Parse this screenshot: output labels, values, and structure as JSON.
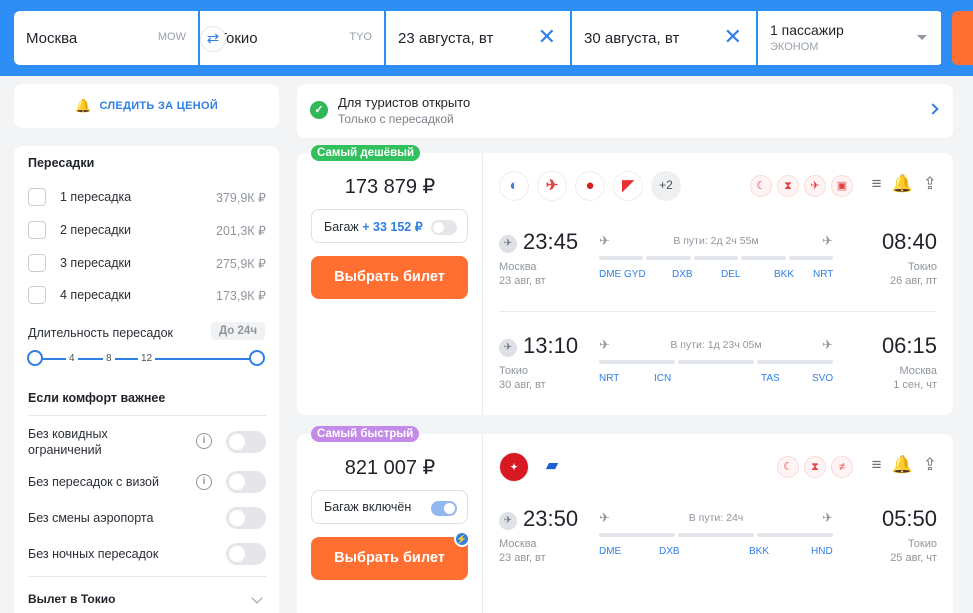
{
  "search": {
    "from": "Москва",
    "from_code": "MOW",
    "to": "Токио",
    "to_code": "TYO",
    "depart_date": "23 августа, вт",
    "return_date": "30 августа, вт",
    "passengers": "1 пассажир",
    "cabin": "ЭКОНОМ"
  },
  "track_price": "СЛЕДИТЬ ЗА ЦЕНОЙ",
  "filters": {
    "stops_title": "Пересадки",
    "stops": [
      {
        "label": "1 пересадка",
        "price": "379,9К ₽"
      },
      {
        "label": "2 пересадки",
        "price": "201,3К ₽"
      },
      {
        "label": "3 пересадки",
        "price": "275,9К ₽"
      },
      {
        "label": "4 пересадки",
        "price": "173,9К ₽"
      }
    ],
    "duration_label": "Длительность пересадок",
    "duration_badge": "До 24ч",
    "duration_ticks": [
      "4",
      "8",
      "12"
    ],
    "comfort_title": "Если комфорт важнее",
    "comfort": [
      {
        "label": "Без ковидных ограничений"
      },
      {
        "label": "Без пересадок с визой"
      },
      {
        "label": "Без смены аэропорта"
      },
      {
        "label": "Без ночных пересадок"
      }
    ],
    "departure_title": "Вылет в Токио"
  },
  "notice": {
    "title": "Для туристов открыто",
    "subtitle": "Только с пересадкой"
  },
  "tickets": [
    {
      "tag": "Самый дешёвый",
      "price": "173 879 ₽",
      "baggage_label": "Багаж",
      "baggage_price": "+ 33 152 ₽",
      "baggage_on": false,
      "buy": "Выбрать билет",
      "extra_airlines": "+2",
      "segments": [
        {
          "dep_time": "23:45",
          "arr_time": "08:40",
          "dep_city": "Москва",
          "dep_date": "23 авг, вт",
          "arr_city": "Токио",
          "arr_date": "26 авг, пт",
          "duration": "В пути: 2д 2ч 55м",
          "stops": [
            "DME",
            "GYD",
            "DXB",
            "DEL",
            "BKK",
            "NRT"
          ]
        },
        {
          "dep_time": "13:10",
          "arr_time": "06:15",
          "dep_city": "Токио",
          "dep_date": "30 авг, вт",
          "arr_city": "Москва",
          "arr_date": "1 сен, чт",
          "duration": "В пути: 1д 23ч 05м",
          "stops": [
            "NRT",
            "ICN",
            "TAS",
            "SVO"
          ]
        }
      ]
    },
    {
      "tag": "Самый быстрый",
      "price": "821 007 ₽",
      "baggage_label": "Багаж включён",
      "baggage_on": true,
      "buy": "Выбрать билет",
      "segments": [
        {
          "dep_time": "23:50",
          "arr_time": "05:50",
          "dep_city": "Москва",
          "dep_date": "23 авг, вт",
          "arr_city": "Токио",
          "arr_date": "25 авг, чт",
          "duration": "В пути: 24ч",
          "stops": [
            "DME",
            "DXB",
            "BKK",
            "HND"
          ]
        }
      ]
    }
  ],
  "colors": {
    "accent": "#2f8ef5",
    "cta": "#ff6f32",
    "cheap_tag": "#33c15d",
    "fast_tag": "#c48ae8"
  }
}
